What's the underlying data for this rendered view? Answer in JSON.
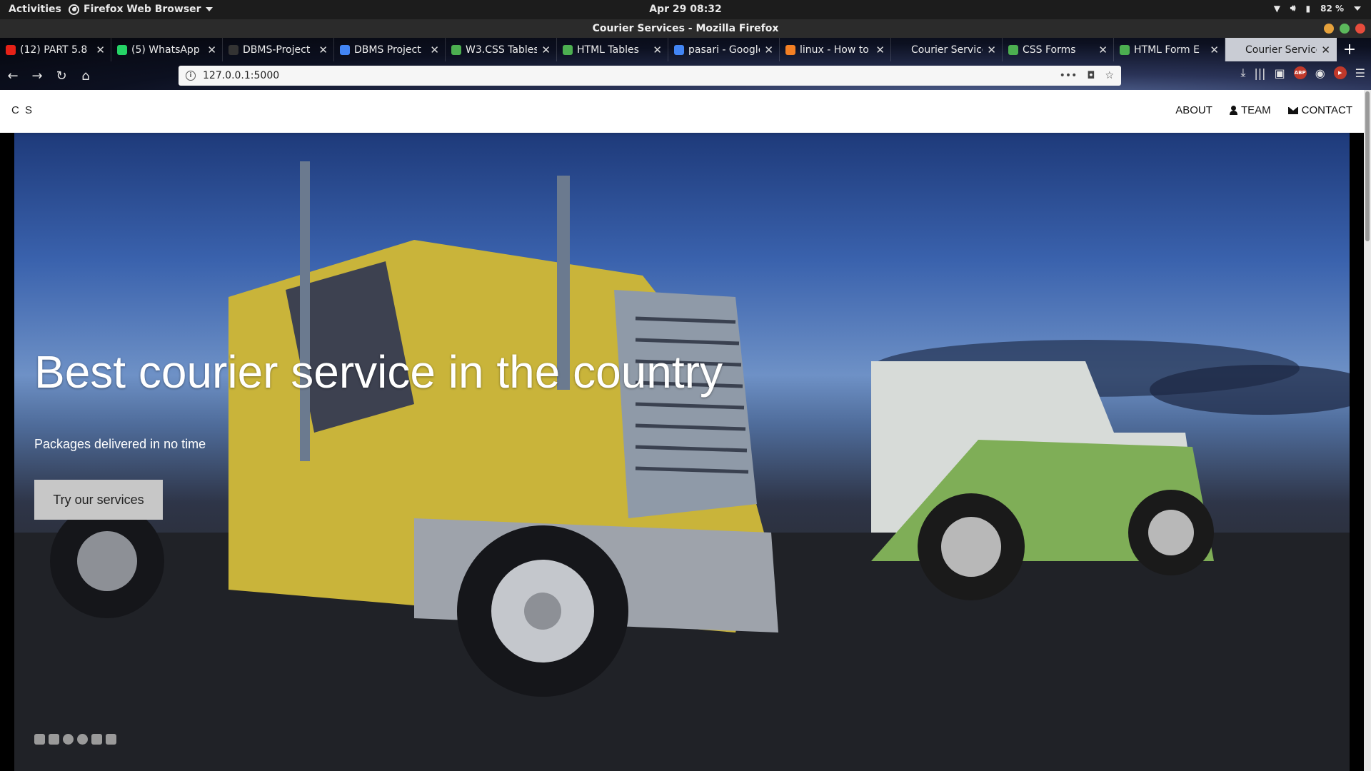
{
  "system": {
    "activities": "Activities",
    "app_name": "Firefox Web Browser",
    "clock": "Apr 29  08:32",
    "battery": "82 %"
  },
  "window": {
    "title": "Courier Services - Mozilla Firefox"
  },
  "tabs": [
    {
      "label": "(12) PART 5.8",
      "favicon_color": "#e62117",
      "favicon": "youtube-icon"
    },
    {
      "label": "(5) WhatsApp",
      "favicon_color": "#25d366",
      "favicon": "whatsapp-icon"
    },
    {
      "label": "DBMS-Project",
      "favicon_color": "#333333",
      "favicon": "github-icon"
    },
    {
      "label": "DBMS Project",
      "favicon_color": "#4285f4",
      "favicon": "docs-icon"
    },
    {
      "label": "W3.CSS Tables",
      "favicon_color": "#4caf50",
      "favicon": "w3schools-icon"
    },
    {
      "label": "HTML Tables",
      "favicon_color": "#4caf50",
      "favicon": "w3schools-icon"
    },
    {
      "label": "pasari - Google",
      "favicon_color": "#4285f4",
      "favicon": "docs-icon"
    },
    {
      "label": "linux - How to",
      "favicon_color": "#f48024",
      "favicon": "stackexchange-icon"
    },
    {
      "label": "Courier Services",
      "favicon_color": "transparent",
      "favicon": "blank-icon"
    },
    {
      "label": "CSS Forms",
      "favicon_color": "#4caf50",
      "favicon": "w3schools-icon"
    },
    {
      "label": "HTML Form E",
      "favicon_color": "#4caf50",
      "favicon": "w3schools-icon"
    },
    {
      "label": "Courier Services",
      "favicon_color": "transparent",
      "favicon": "blank-icon",
      "active": true
    }
  ],
  "toolbar": {
    "url": "127.0.0.1:5000"
  },
  "site": {
    "brand": "C S",
    "nav": {
      "about": "ABOUT",
      "team": "TEAM",
      "contact": "CONTACT"
    },
    "hero": {
      "title": "Best courier service in the country",
      "subtitle": "Packages delivered in no time",
      "cta": "Try our services"
    },
    "social": [
      "facebook-icon",
      "instagram-icon",
      "snapchat-icon",
      "pinterest-icon",
      "twitter-icon",
      "linkedin-icon"
    ]
  }
}
